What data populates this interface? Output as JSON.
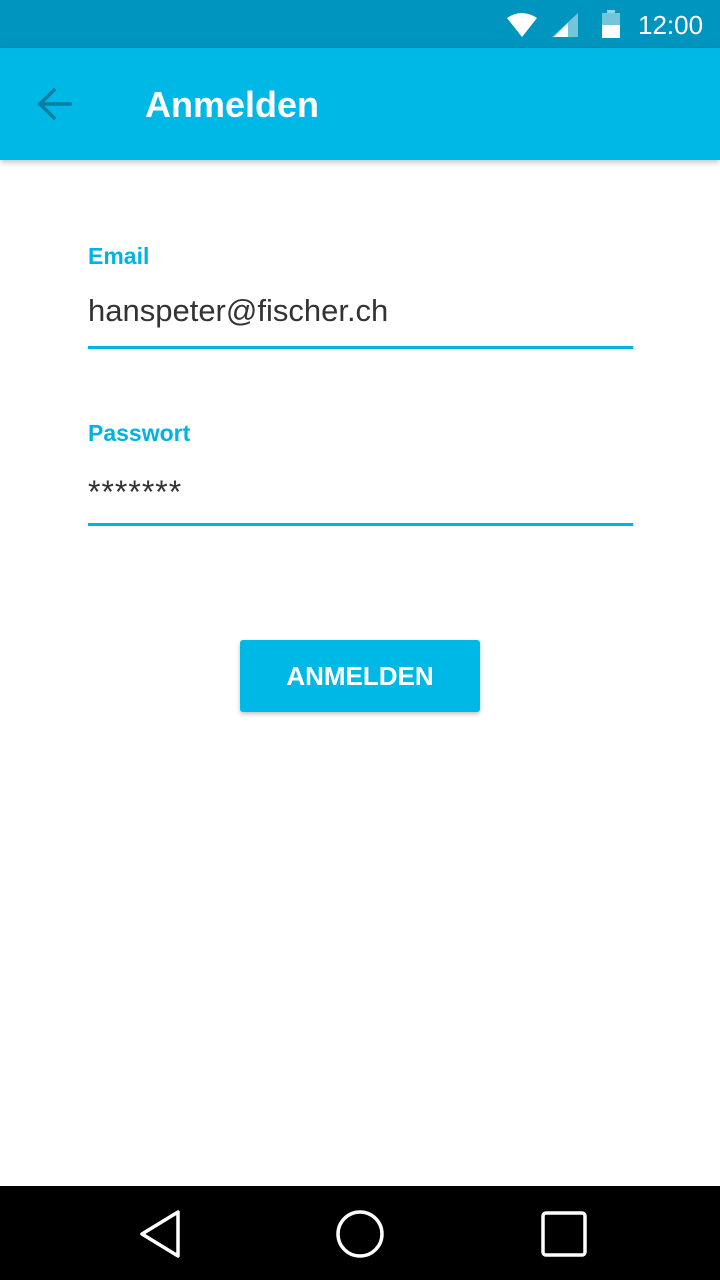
{
  "status_bar": {
    "time": "12:00",
    "icons": [
      "wifi-icon",
      "signal-icon",
      "battery-icon"
    ]
  },
  "app_bar": {
    "title": "Anmelden",
    "back_icon": "arrow-back-icon"
  },
  "form": {
    "email": {
      "label": "Email",
      "value": "hanspeter@fischer.ch"
    },
    "password": {
      "label": "Passwort",
      "value": "*******"
    },
    "submit_label": "ANMELDEN"
  },
  "nav_bar": {
    "icons": [
      "nav-back-icon",
      "nav-home-icon",
      "nav-recents-icon"
    ]
  },
  "colors": {
    "status_bar": "#0095BE",
    "app_bar": "#00B8E6",
    "accent": "#00B3E3",
    "nav_bar": "#000000"
  }
}
